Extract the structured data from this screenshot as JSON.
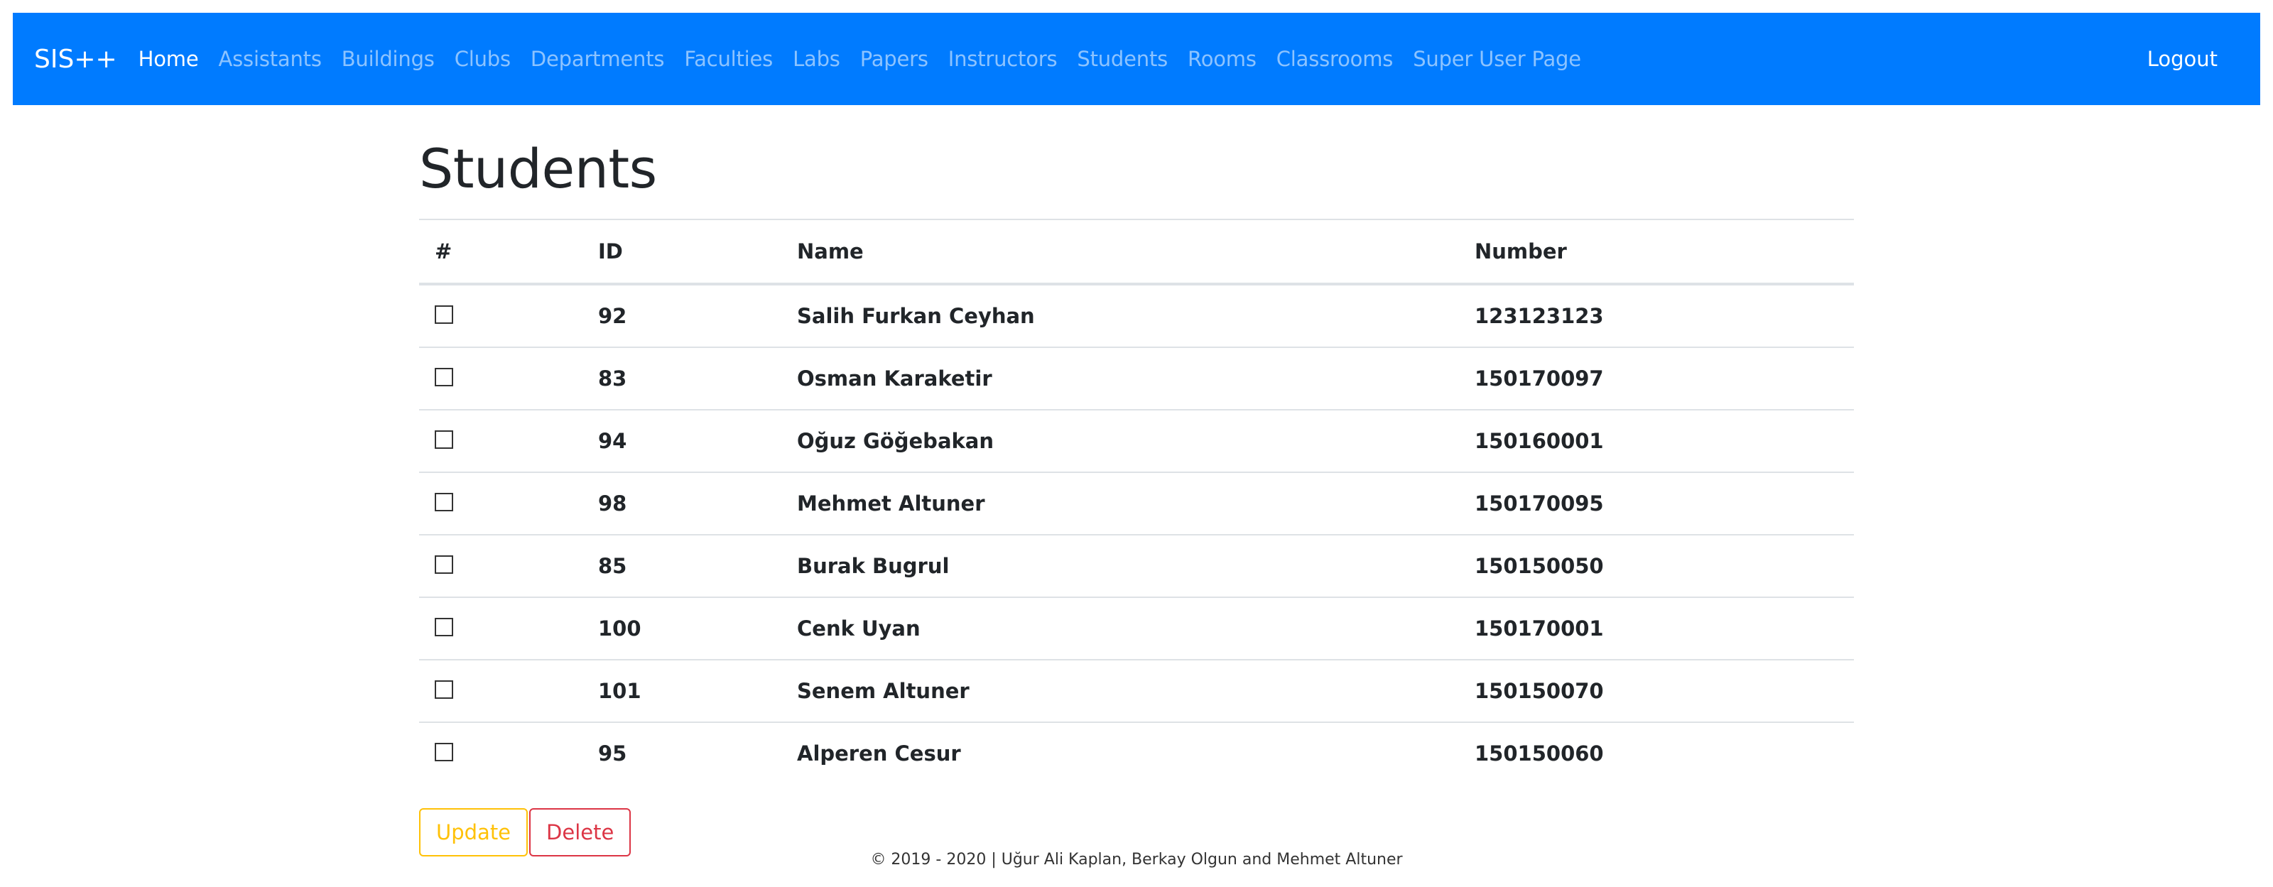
{
  "navbar": {
    "brand": "SIS++",
    "links": [
      {
        "label": "Home",
        "active": true
      },
      {
        "label": "Assistants"
      },
      {
        "label": "Buildings"
      },
      {
        "label": "Clubs"
      },
      {
        "label": "Departments"
      },
      {
        "label": "Faculties"
      },
      {
        "label": "Labs"
      },
      {
        "label": "Papers"
      },
      {
        "label": "Instructors"
      },
      {
        "label": "Students"
      },
      {
        "label": "Rooms"
      },
      {
        "label": "Classrooms"
      },
      {
        "label": "Super User Page"
      }
    ],
    "logout": "Logout",
    "background_color": "#007bff"
  },
  "main": {
    "title": "Students",
    "table": {
      "headers": [
        "#",
        "ID",
        "Name",
        "Number"
      ],
      "rows": [
        {
          "checked": false,
          "id": "92",
          "name": "Salih Furkan Ceyhan",
          "number": "123123123"
        },
        {
          "checked": false,
          "id": "83",
          "name": "Osman Karaketir",
          "number": "150170097"
        },
        {
          "checked": false,
          "id": "94",
          "name": "Oğuz Göğebakan",
          "number": "150160001"
        },
        {
          "checked": false,
          "id": "98",
          "name": "Mehmet Altuner",
          "number": "150170095"
        },
        {
          "checked": false,
          "id": "85",
          "name": "Burak Bugrul",
          "number": "150150050"
        },
        {
          "checked": false,
          "id": "100",
          "name": "Cenk Uyan",
          "number": "150170001"
        },
        {
          "checked": false,
          "id": "101",
          "name": "Senem Altuner",
          "number": "150150070"
        },
        {
          "checked": false,
          "id": "95",
          "name": "Alperen Cesur",
          "number": "150150060"
        }
      ]
    },
    "buttons": {
      "update": "Update",
      "delete": "Delete"
    }
  },
  "footer": {
    "text": "© 2019 - 2020 | Uğur Ali Kaplan, Berkay Olgun and Mehmet Altuner"
  }
}
